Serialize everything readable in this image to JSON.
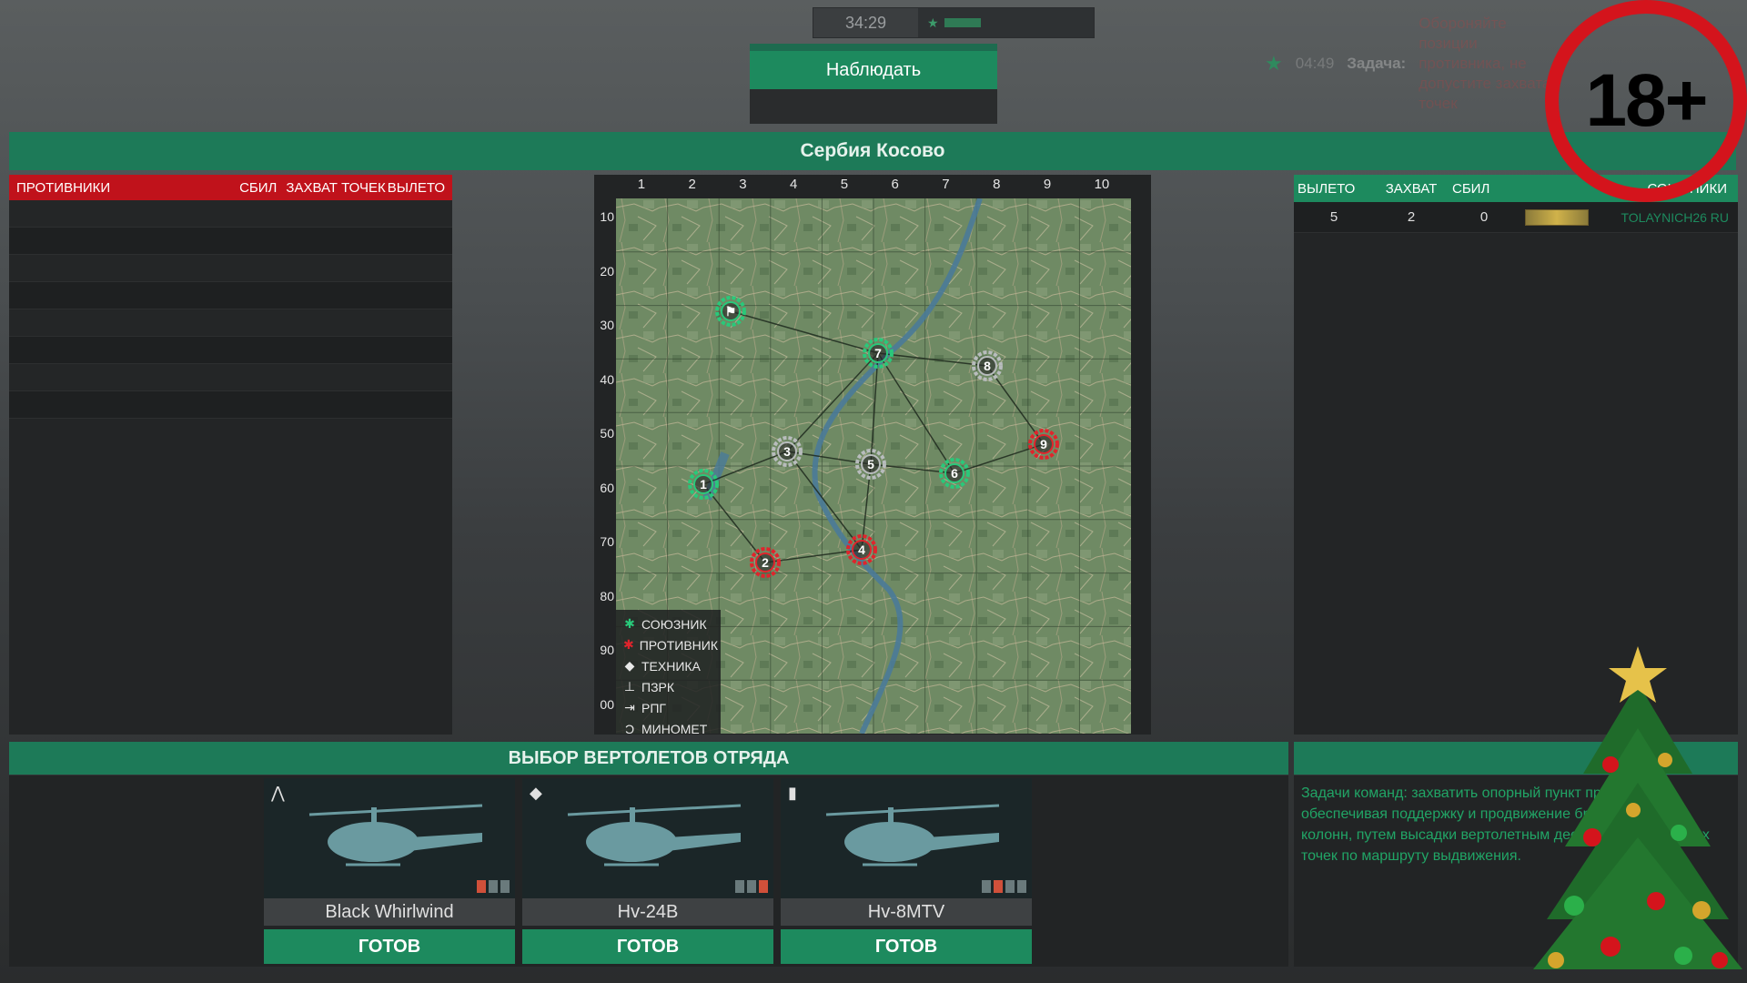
{
  "top_bar": {
    "timer": "34:29"
  },
  "observe": {
    "label": "Наблюдать"
  },
  "task": {
    "time": "04:49",
    "label": "Задача:",
    "text": "Обороняйте позиции противника, не допустите захвата точек"
  },
  "title": "Сербия Косово",
  "enemies": {
    "header_title": "ПРОТИВНИКИ",
    "col_kills": "СБИЛ",
    "col_capture": "ЗАХВАТ ТОЧЕК",
    "col_sorties": "ВЫЛЕТО",
    "rows": 8
  },
  "map": {
    "col_labels": [
      "1",
      "2",
      "3",
      "4",
      "5",
      "6",
      "7",
      "8",
      "9",
      "10"
    ],
    "row_labels": [
      "10",
      "20",
      "30",
      "40",
      "50",
      "60",
      "70",
      "80",
      "90",
      "00"
    ],
    "legend": [
      {
        "icon": "ally-icon",
        "symbol": "✱",
        "color": "#29c97a",
        "label": "СОЮЗНИК"
      },
      {
        "icon": "enemy-icon",
        "symbol": "✱",
        "color": "#e0242c",
        "label": "ПРОТИВНИК"
      },
      {
        "icon": "vehicle-icon",
        "symbol": "◆",
        "color": "#e8e8e8",
        "label": "ТЕХНИКА"
      },
      {
        "icon": "manpads-icon",
        "symbol": "⊥",
        "color": "#e8e8e8",
        "label": "ПЗРК"
      },
      {
        "icon": "rpg-icon",
        "symbol": "⇥",
        "color": "#e8e8e8",
        "label": "РПГ"
      },
      {
        "icon": "mortar-icon",
        "symbol": "Ͻ",
        "color": "#e8e8e8",
        "label": "МИНОМЕТ"
      }
    ],
    "points": [
      {
        "id": "1",
        "owner": "ally"
      },
      {
        "id": "2",
        "owner": "enemy"
      },
      {
        "id": "3",
        "owner": "neutral"
      },
      {
        "id": "4",
        "owner": "enemy"
      },
      {
        "id": "5",
        "owner": "neutral"
      },
      {
        "id": "6",
        "owner": "ally"
      },
      {
        "id": "7",
        "owner": "ally"
      },
      {
        "id": "8",
        "owner": "neutral"
      },
      {
        "id": "9",
        "owner": "enemy"
      },
      {
        "id": "flag",
        "owner": "ally"
      }
    ]
  },
  "allies": {
    "col_sorties": "ВЫЛЕТО",
    "col_capture": "ЗАХВАТ",
    "col_kills": "СБИЛ",
    "col_title": "СОЮЗНИКИ",
    "row": {
      "sorties": "5",
      "capture": "2",
      "kills": "0",
      "name": "TOLAYNICH26 RU"
    }
  },
  "helicopters": {
    "title": "ВЫБОР ВЕРТОЛЕТОВ ОТРЯДА",
    "cards": [
      {
        "name": "Black Whirlwind",
        "ready": "ГОТОВ",
        "icon": "attack-heli-icon",
        "symbol": "⋀",
        "bars": [
          "red",
          "gray",
          "gray"
        ]
      },
      {
        "name": "Hv-24B",
        "ready": "ГОТОВ",
        "icon": "gunship-heli-icon",
        "symbol": "◆",
        "bars": [
          "gray",
          "gray",
          "red"
        ]
      },
      {
        "name": "Hv-8MTV",
        "ready": "ГОТОВ",
        "icon": "transport-heli-icon",
        "symbol": "▮",
        "bars": [
          "gray",
          "red",
          "gray",
          "gray"
        ]
      }
    ]
  },
  "description": "Задачи команд: захватить опорный пункт противника обеспечивая поддержку и продвижение бронетанковых колонн, путем высадки вертолетным десантом контрольных точек по маршруту выдвижения.",
  "badge": "18+",
  "colors": {
    "accent": "#1d8a5e",
    "enemy": "#c0121b",
    "ally_text": "#21a566"
  }
}
